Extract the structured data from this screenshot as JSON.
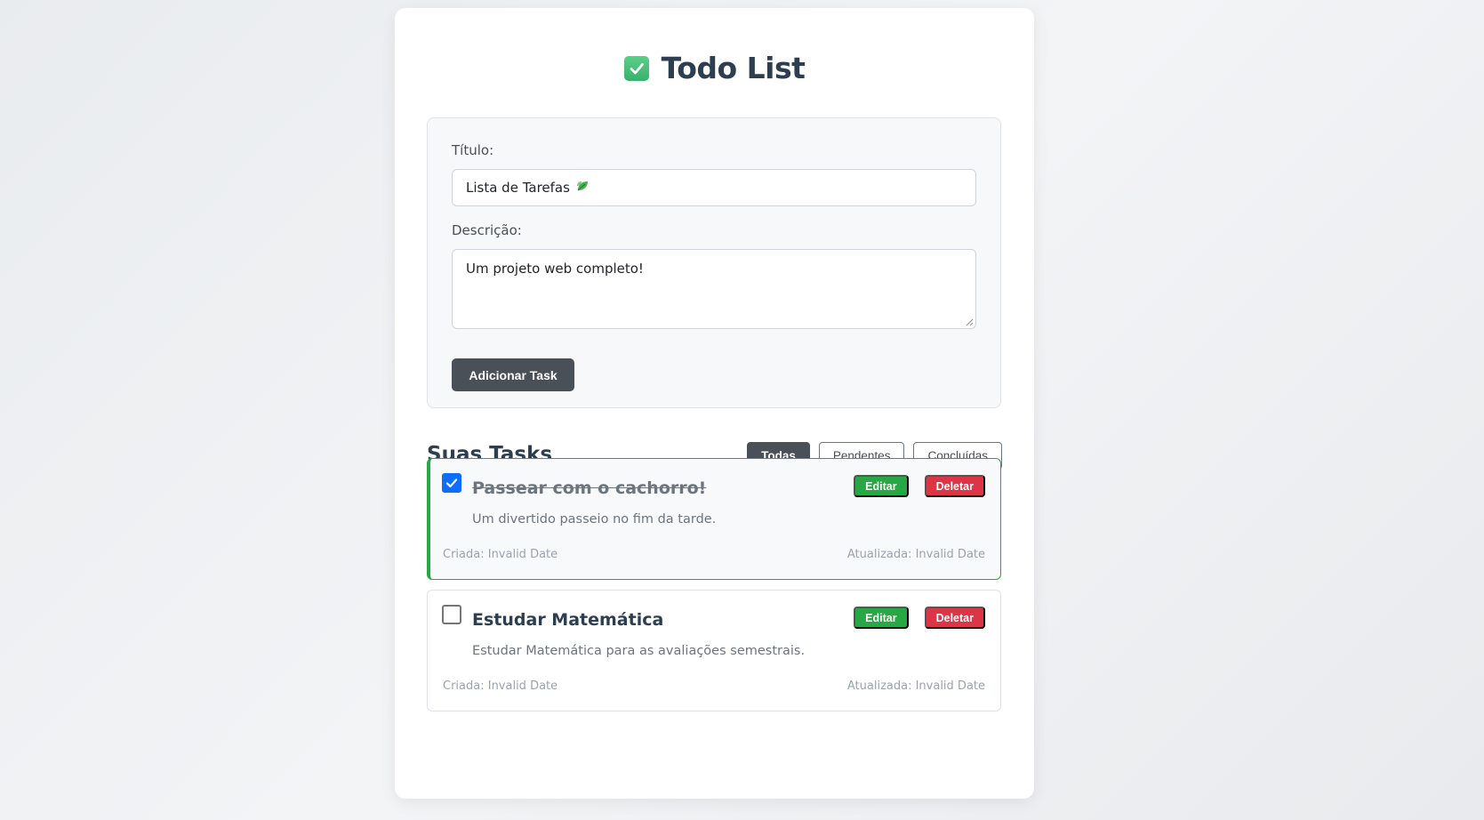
{
  "header": {
    "title": "Todo List",
    "icon": "check-box-icon"
  },
  "form": {
    "title_label": "Título:",
    "title_value": "Lista de Tarefas",
    "title_emoji_icon": "leaf-icon",
    "description_label": "Descrição:",
    "description_value": "Um projeto web completo!",
    "submit_label": "Adicionar Task"
  },
  "tasks_section": {
    "heading": "Suas Tasks",
    "filters": [
      {
        "label": "Todas",
        "active": true
      },
      {
        "label": "Pendentes",
        "active": false
      },
      {
        "label": "Concluídas",
        "active": false
      }
    ]
  },
  "tasks": [
    {
      "title": "Passear com o cachorro!",
      "description": "Um divertido passeio no fim da tarde.",
      "completed": true,
      "edit_label": "Editar",
      "delete_label": "Deletar",
      "created": "Criada: Invalid Date",
      "updated": "Atualizada: Invalid Date"
    },
    {
      "title": "Estudar Matemática",
      "description": "Estudar Matemática para as avaliações semestrais.",
      "completed": false,
      "edit_label": "Editar",
      "delete_label": "Deletar",
      "created": "Criada: Invalid Date",
      "updated": "Atualizada: Invalid Date"
    }
  ],
  "colors": {
    "primary_dark": "#495057",
    "success": "#28a745",
    "danger": "#dc3545",
    "checkbox": "#0d6efd"
  }
}
